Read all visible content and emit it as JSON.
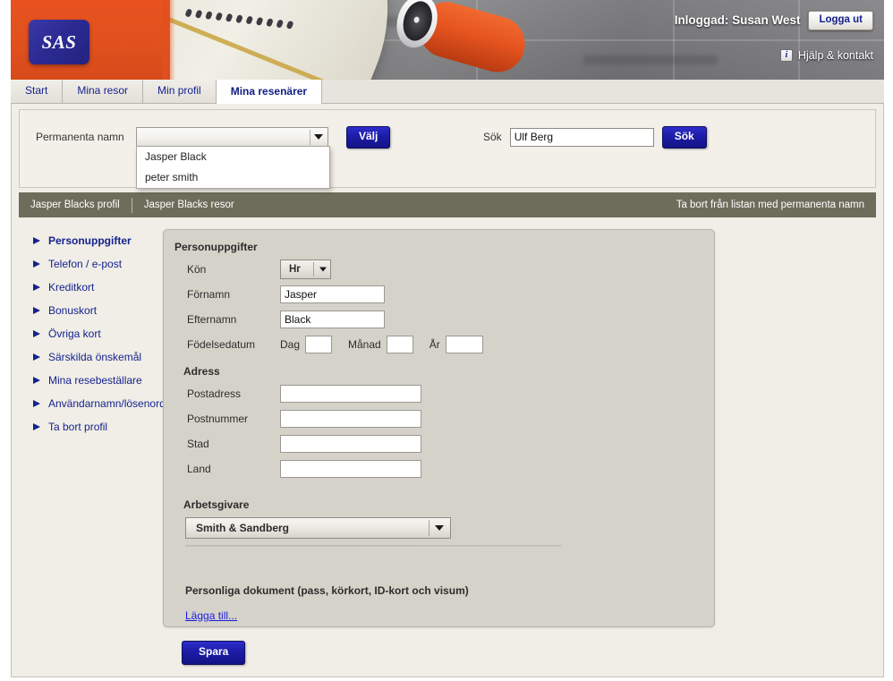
{
  "brand": {
    "logo_text": "SAS",
    "logo_color": "#2c2b93",
    "accent_color": "#e0511e"
  },
  "header": {
    "logged_in_label": "Inloggad: Susan West",
    "logout_label": "Logga ut",
    "help_label": "Hjälp & kontakt",
    "info_icon_glyph": "i"
  },
  "tabs": [
    {
      "label": "Start",
      "active": false
    },
    {
      "label": "Mina resor",
      "active": false
    },
    {
      "label": "Min profil",
      "active": false
    },
    {
      "label": "Mina resenärer",
      "active": true
    }
  ],
  "selector": {
    "permanent_label": "Permanenta namn",
    "combo_value": "",
    "choose_button": "Välj",
    "dropdown_open": true,
    "dropdown_options": [
      "Jasper Black",
      "peter smith"
    ],
    "search_label": "Sök",
    "search_value": "Ulf Berg",
    "search_placeholder": "",
    "search_button": "Sök"
  },
  "profile_bar": {
    "left_items": [
      "Jasper Blacks profil",
      "Jasper Blacks resor"
    ],
    "right_action": "Ta bort från listan med permanenta namn"
  },
  "sidebar": {
    "items": [
      {
        "label": "Personuppgifter",
        "active": true
      },
      {
        "label": "Telefon / e-post",
        "active": false
      },
      {
        "label": "Kreditkort",
        "active": false
      },
      {
        "label": "Bonuskort",
        "active": false
      },
      {
        "label": "Övriga kort",
        "active": false
      },
      {
        "label": "Särskilda önskemål",
        "active": false
      },
      {
        "label": "Mina resebeställare",
        "active": false
      },
      {
        "label": "Användarnamn/lösenord",
        "active": false
      },
      {
        "label": "Ta bort profil",
        "active": false
      }
    ]
  },
  "form": {
    "person_section_title": "Personuppgifter",
    "gender_label": "Kön",
    "gender_value": "Hr",
    "firstname_label": "Förnamn",
    "firstname_value": "Jasper",
    "lastname_label": "Efternamn",
    "lastname_value": "Black",
    "dob_label": "Födelsedatum",
    "dob_day_label": "Dag",
    "dob_day_value": "",
    "dob_month_label": "Månad",
    "dob_month_value": "",
    "dob_year_label": "År",
    "dob_year_value": "",
    "address_section_title": "Adress",
    "street_label": "Postadress",
    "street_value": "",
    "zip_label": "Postnummer",
    "zip_value": "",
    "city_label": "Stad",
    "city_value": "",
    "country_label": "Land",
    "country_value": "",
    "employer_section_title": "Arbetsgivare",
    "employer_value": "Smith & Sandberg",
    "documents_title": "Personliga dokument (pass, körkort, ID-kort och visum)",
    "add_link": "Lägga till..."
  },
  "footer": {
    "save_label": "Spara"
  }
}
